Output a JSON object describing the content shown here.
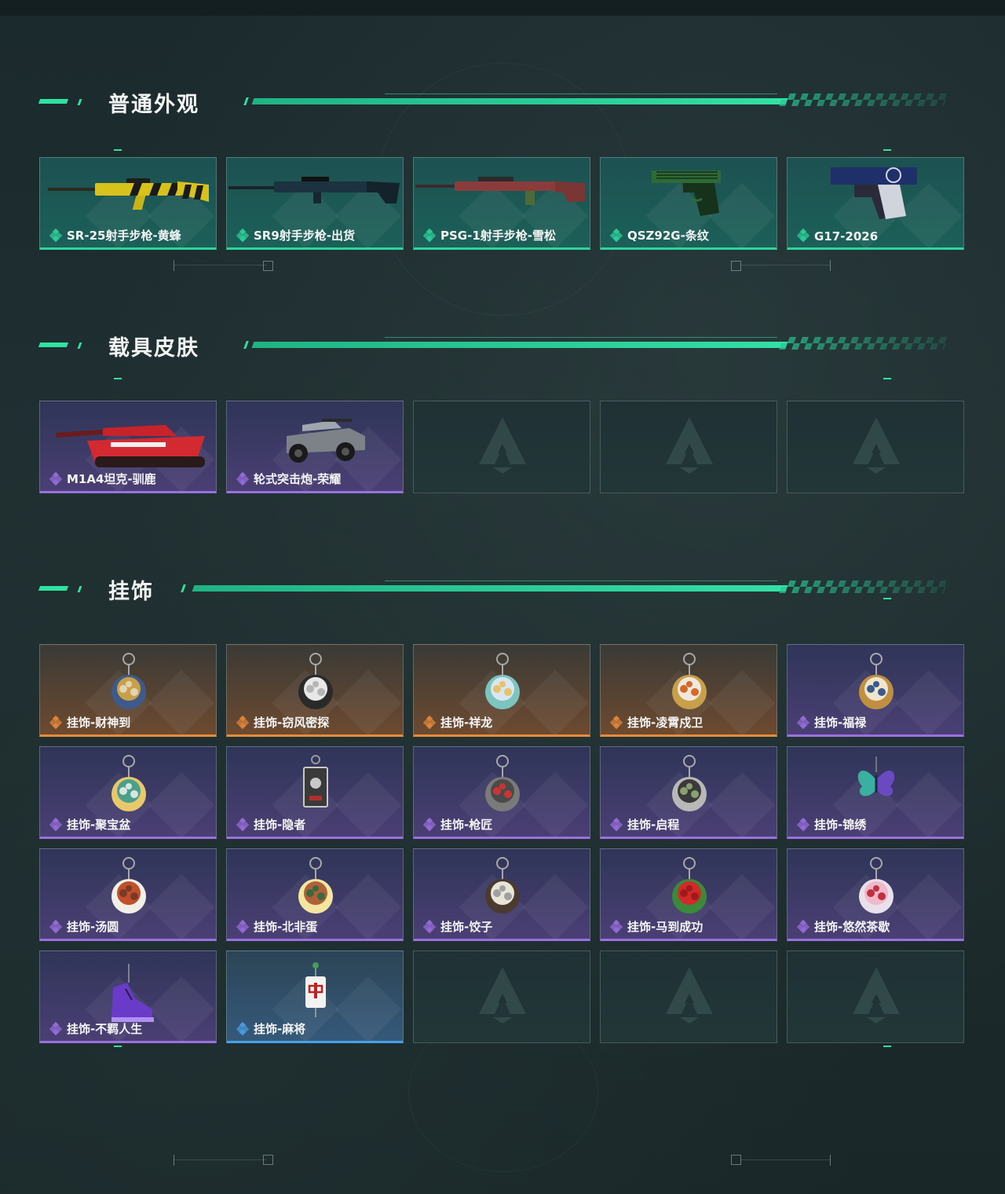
{
  "sections": [
    {
      "title": "普通外观",
      "items": [
        {
          "label": "SR-25射手步枪-黄蜂",
          "rarity": "green",
          "icon": "rifle-yellow-icon"
        },
        {
          "label": "SR9射手步枪-出货",
          "rarity": "green",
          "icon": "rifle-dark-icon"
        },
        {
          "label": "PSG-1射手步枪-雪松",
          "rarity": "green",
          "icon": "rifle-red-icon"
        },
        {
          "label": "QSZ92G-条纹",
          "rarity": "green",
          "icon": "pistol-green-icon"
        },
        {
          "label": "G17-2026",
          "rarity": "green",
          "icon": "pistol-blue-icon"
        }
      ]
    },
    {
      "title": "载具皮肤",
      "items": [
        {
          "label": "M1A4坦克-驯鹿",
          "rarity": "purple",
          "icon": "tank-icon"
        },
        {
          "label": "轮式突击炮-荣耀",
          "rarity": "purple",
          "icon": "armored-car-icon"
        },
        {
          "label": "",
          "rarity": "empty"
        },
        {
          "label": "",
          "rarity": "empty"
        },
        {
          "label": "",
          "rarity": "empty"
        }
      ]
    },
    {
      "title": "挂饰",
      "items": [
        {
          "label": "挂饰-财神到",
          "rarity": "orange",
          "icon": "charm-fortune-icon"
        },
        {
          "label": "挂饰-窃风密探",
          "rarity": "orange",
          "icon": "charm-detective-icon"
        },
        {
          "label": "挂饰-祥龙",
          "rarity": "orange",
          "icon": "charm-dragon-icon"
        },
        {
          "label": "挂饰-凌霄戍卫",
          "rarity": "orange",
          "icon": "charm-guard-icon"
        },
        {
          "label": "挂饰-福禄",
          "rarity": "purple",
          "icon": "charm-gourd-icon"
        },
        {
          "label": "挂饰-聚宝盆",
          "rarity": "purple",
          "icon": "charm-treasure-bowl-icon"
        },
        {
          "label": "挂饰-隐者",
          "rarity": "purple",
          "icon": "charm-hermit-card-icon"
        },
        {
          "label": "挂饰-枪匠",
          "rarity": "purple",
          "icon": "charm-gunsmith-icon"
        },
        {
          "label": "挂饰-启程",
          "rarity": "purple",
          "icon": "charm-compass-icon"
        },
        {
          "label": "挂饰-锦绣",
          "rarity": "purple",
          "icon": "charm-butterfly-icon"
        },
        {
          "label": "挂饰-汤圆",
          "rarity": "purple",
          "icon": "charm-tangyuan-icon"
        },
        {
          "label": "挂饰-北非蛋",
          "rarity": "purple",
          "icon": "charm-shakshuka-icon"
        },
        {
          "label": "挂饰-饺子",
          "rarity": "purple",
          "icon": "charm-dumpling-icon"
        },
        {
          "label": "挂饰-马到成功",
          "rarity": "purple",
          "icon": "charm-horse-icon"
        },
        {
          "label": "挂饰-悠然茶歇",
          "rarity": "purple",
          "icon": "charm-cupcake-icon"
        },
        {
          "label": "挂饰-不羁人生",
          "rarity": "purple",
          "icon": "charm-sneaker-icon"
        },
        {
          "label": "挂饰-麻将",
          "rarity": "blue",
          "icon": "charm-mahjong-icon"
        },
        {
          "label": "",
          "rarity": "empty"
        },
        {
          "label": "",
          "rarity": "empty"
        },
        {
          "label": "",
          "rarity": "empty"
        }
      ]
    }
  ],
  "colors": {
    "accent": "#2ee3a0",
    "green": "#2fd49c",
    "purple": "#9a6fe0",
    "orange": "#e88a3c",
    "blue": "#4aa0e6"
  }
}
